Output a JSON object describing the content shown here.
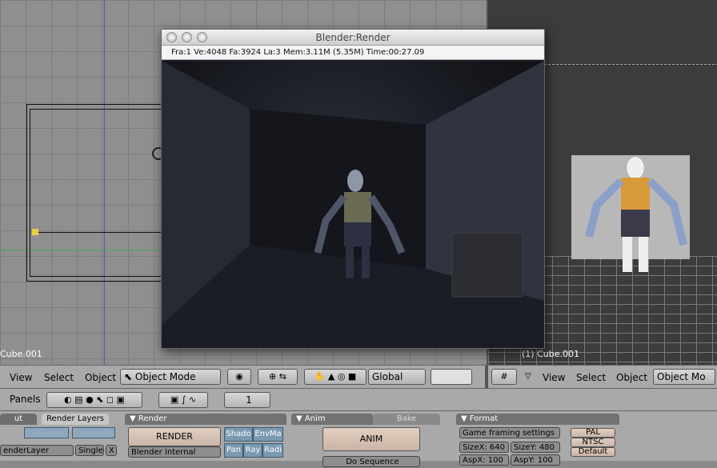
{
  "left_viewport": {
    "object_label": "Cube.001"
  },
  "right_viewport": {
    "object_label": "(1) Cube.001"
  },
  "render_window": {
    "title": "Blender:Render",
    "info": "Fra:1  Ve:4048 Fa:3924 La:3 Mem:3.11M (5.35M) Time:00:27.09"
  },
  "header": {
    "view": "View",
    "select": "Select",
    "object": "Object",
    "mode": "Object Mode",
    "orientation": "Global",
    "view_r": "View",
    "select_r": "Select",
    "object_r": "Object",
    "mode_r": "Object Mo"
  },
  "panels_bar": {
    "label": "Panels",
    "frame": "1"
  },
  "props": {
    "tab_out": "ut",
    "tab_render_layers": "Render Layers",
    "render_layer_name": "enderLayer",
    "single": "Single",
    "close_x": "X",
    "render_panel": "Render",
    "render_btn": "RENDER",
    "engine": "Blender Internal",
    "shado": "Shado",
    "envma": "EnvMa",
    "pan": "Pan",
    "ray": "Ray",
    "radi": "Radi",
    "anim_tab": "Anim",
    "bake_tab": "Bake",
    "anim_btn": "ANIM",
    "do_sequence": "Do Sequence",
    "format_panel": "Format",
    "game_framing": "Game framing settings",
    "sizex": "SizeX: 640",
    "sizey": "SizeY: 480",
    "aspx": "AspX: 100",
    "aspy": "AspY: 100",
    "pal": "PAL",
    "ntsc": "NTSC",
    "default": "Default"
  }
}
